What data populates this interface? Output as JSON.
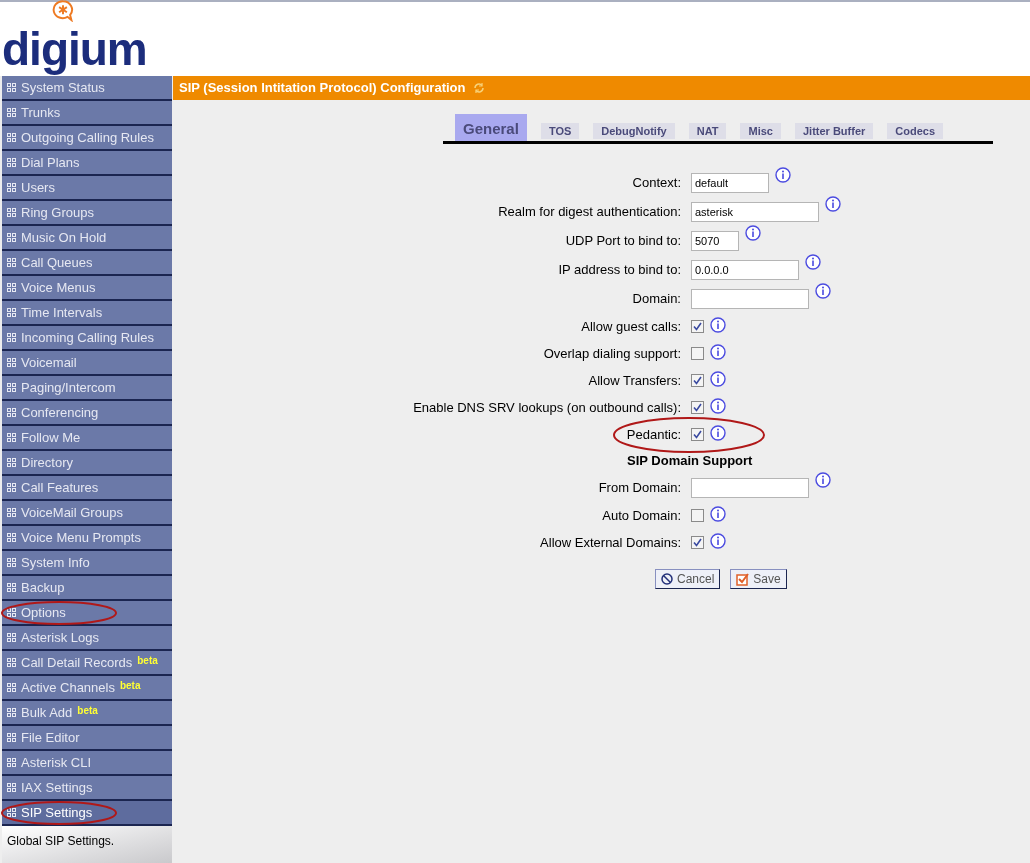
{
  "logo": {
    "text": "digium"
  },
  "sidebar": {
    "items": [
      {
        "label": "System Status",
        "selected": false,
        "circled": false
      },
      {
        "label": "Trunks",
        "selected": false,
        "circled": false
      },
      {
        "label": "Outgoing Calling Rules",
        "selected": false,
        "circled": false
      },
      {
        "label": "Dial Plans",
        "selected": false,
        "circled": false
      },
      {
        "label": "Users",
        "selected": false,
        "circled": false
      },
      {
        "label": "Ring Groups",
        "selected": false,
        "circled": false
      },
      {
        "label": "Music On Hold",
        "selected": false,
        "circled": false
      },
      {
        "label": "Call Queues",
        "selected": false,
        "circled": false
      },
      {
        "label": "Voice Menus",
        "selected": false,
        "circled": false
      },
      {
        "label": "Time Intervals",
        "selected": false,
        "circled": false
      },
      {
        "label": "Incoming Calling Rules",
        "selected": false,
        "circled": false
      },
      {
        "label": "Voicemail",
        "selected": false,
        "circled": false
      },
      {
        "label": "Paging/Intercom",
        "selected": false,
        "circled": false
      },
      {
        "label": "Conferencing",
        "selected": false,
        "circled": false
      },
      {
        "label": "Follow Me",
        "selected": false,
        "circled": false
      },
      {
        "label": "Directory",
        "selected": false,
        "circled": false
      },
      {
        "label": "Call Features",
        "selected": false,
        "circled": false
      },
      {
        "label": "VoiceMail Groups",
        "selected": false,
        "circled": false
      },
      {
        "label": "Voice Menu Prompts",
        "selected": false,
        "circled": false
      },
      {
        "label": "System Info",
        "selected": false,
        "circled": false
      },
      {
        "label": "Backup",
        "selected": false,
        "circled": false
      },
      {
        "label": "Options",
        "selected": false,
        "circled": true
      },
      {
        "label": "Asterisk Logs",
        "selected": false,
        "circled": false
      },
      {
        "label": "Call Detail Records",
        "badge": "beta",
        "selected": false,
        "circled": false
      },
      {
        "label": "Active Channels",
        "badge": "beta",
        "selected": false,
        "circled": false
      },
      {
        "label": "Bulk Add",
        "badge": "beta",
        "selected": false,
        "circled": false
      },
      {
        "label": "File Editor",
        "selected": false,
        "circled": false
      },
      {
        "label": "Asterisk CLI",
        "selected": false,
        "circled": false
      },
      {
        "label": "IAX Settings",
        "selected": false,
        "circled": false
      },
      {
        "label": "SIP Settings",
        "selected": true,
        "circled": true
      }
    ],
    "description": "Global SIP Settings."
  },
  "page_title": "SIP (Session Intitation Protocol) Configuration",
  "tabs": [
    {
      "label": "General",
      "selected": true
    },
    {
      "label": "TOS",
      "selected": false
    },
    {
      "label": "DebugNotify",
      "selected": false
    },
    {
      "label": "NAT",
      "selected": false
    },
    {
      "label": "Misc",
      "selected": false
    },
    {
      "label": "Jitter Buffer",
      "selected": false
    },
    {
      "label": "Codecs",
      "selected": false
    }
  ],
  "form": [
    {
      "kind": "text",
      "label": "Context:",
      "value": "default",
      "circled": false
    },
    {
      "kind": "text",
      "label": "Realm for digest authentication:",
      "value": "asterisk",
      "circled": false
    },
    {
      "kind": "text",
      "label": "UDP Port to bind to:",
      "value": "5070",
      "circled": false
    },
    {
      "kind": "text",
      "label": "IP address to bind to:",
      "value": "0.0.0.0",
      "circled": false
    },
    {
      "kind": "text",
      "label": "Domain:",
      "circled": false
    },
    {
      "kind": "checkbox",
      "label": "Allow guest calls:",
      "checked": true,
      "circled": false
    },
    {
      "kind": "checkbox",
      "label": "Overlap dialing support:",
      "checked": false,
      "circled": false
    },
    {
      "kind": "checkbox",
      "label": "Allow Transfers:",
      "checked": true,
      "circled": false
    },
    {
      "kind": "checkbox",
      "label": "Enable DNS SRV lookups (on outbound calls):",
      "checked": true,
      "circled": false
    },
    {
      "kind": "checkbox",
      "label": "Pedantic:",
      "checked": true,
      "circled": true
    },
    {
      "kind": "heading",
      "label": "SIP Domain Support"
    },
    {
      "kind": "text",
      "label": "From Domain:",
      "circled": false
    },
    {
      "kind": "checkbox",
      "label": "Auto Domain:",
      "checked": false,
      "circled": false
    },
    {
      "kind": "checkbox",
      "label": "Allow External Domains:",
      "checked": true,
      "circled": false
    }
  ],
  "buttons": [
    {
      "kind": "cancel",
      "label": "Cancel"
    },
    {
      "kind": "save",
      "label": "Save"
    }
  ]
}
